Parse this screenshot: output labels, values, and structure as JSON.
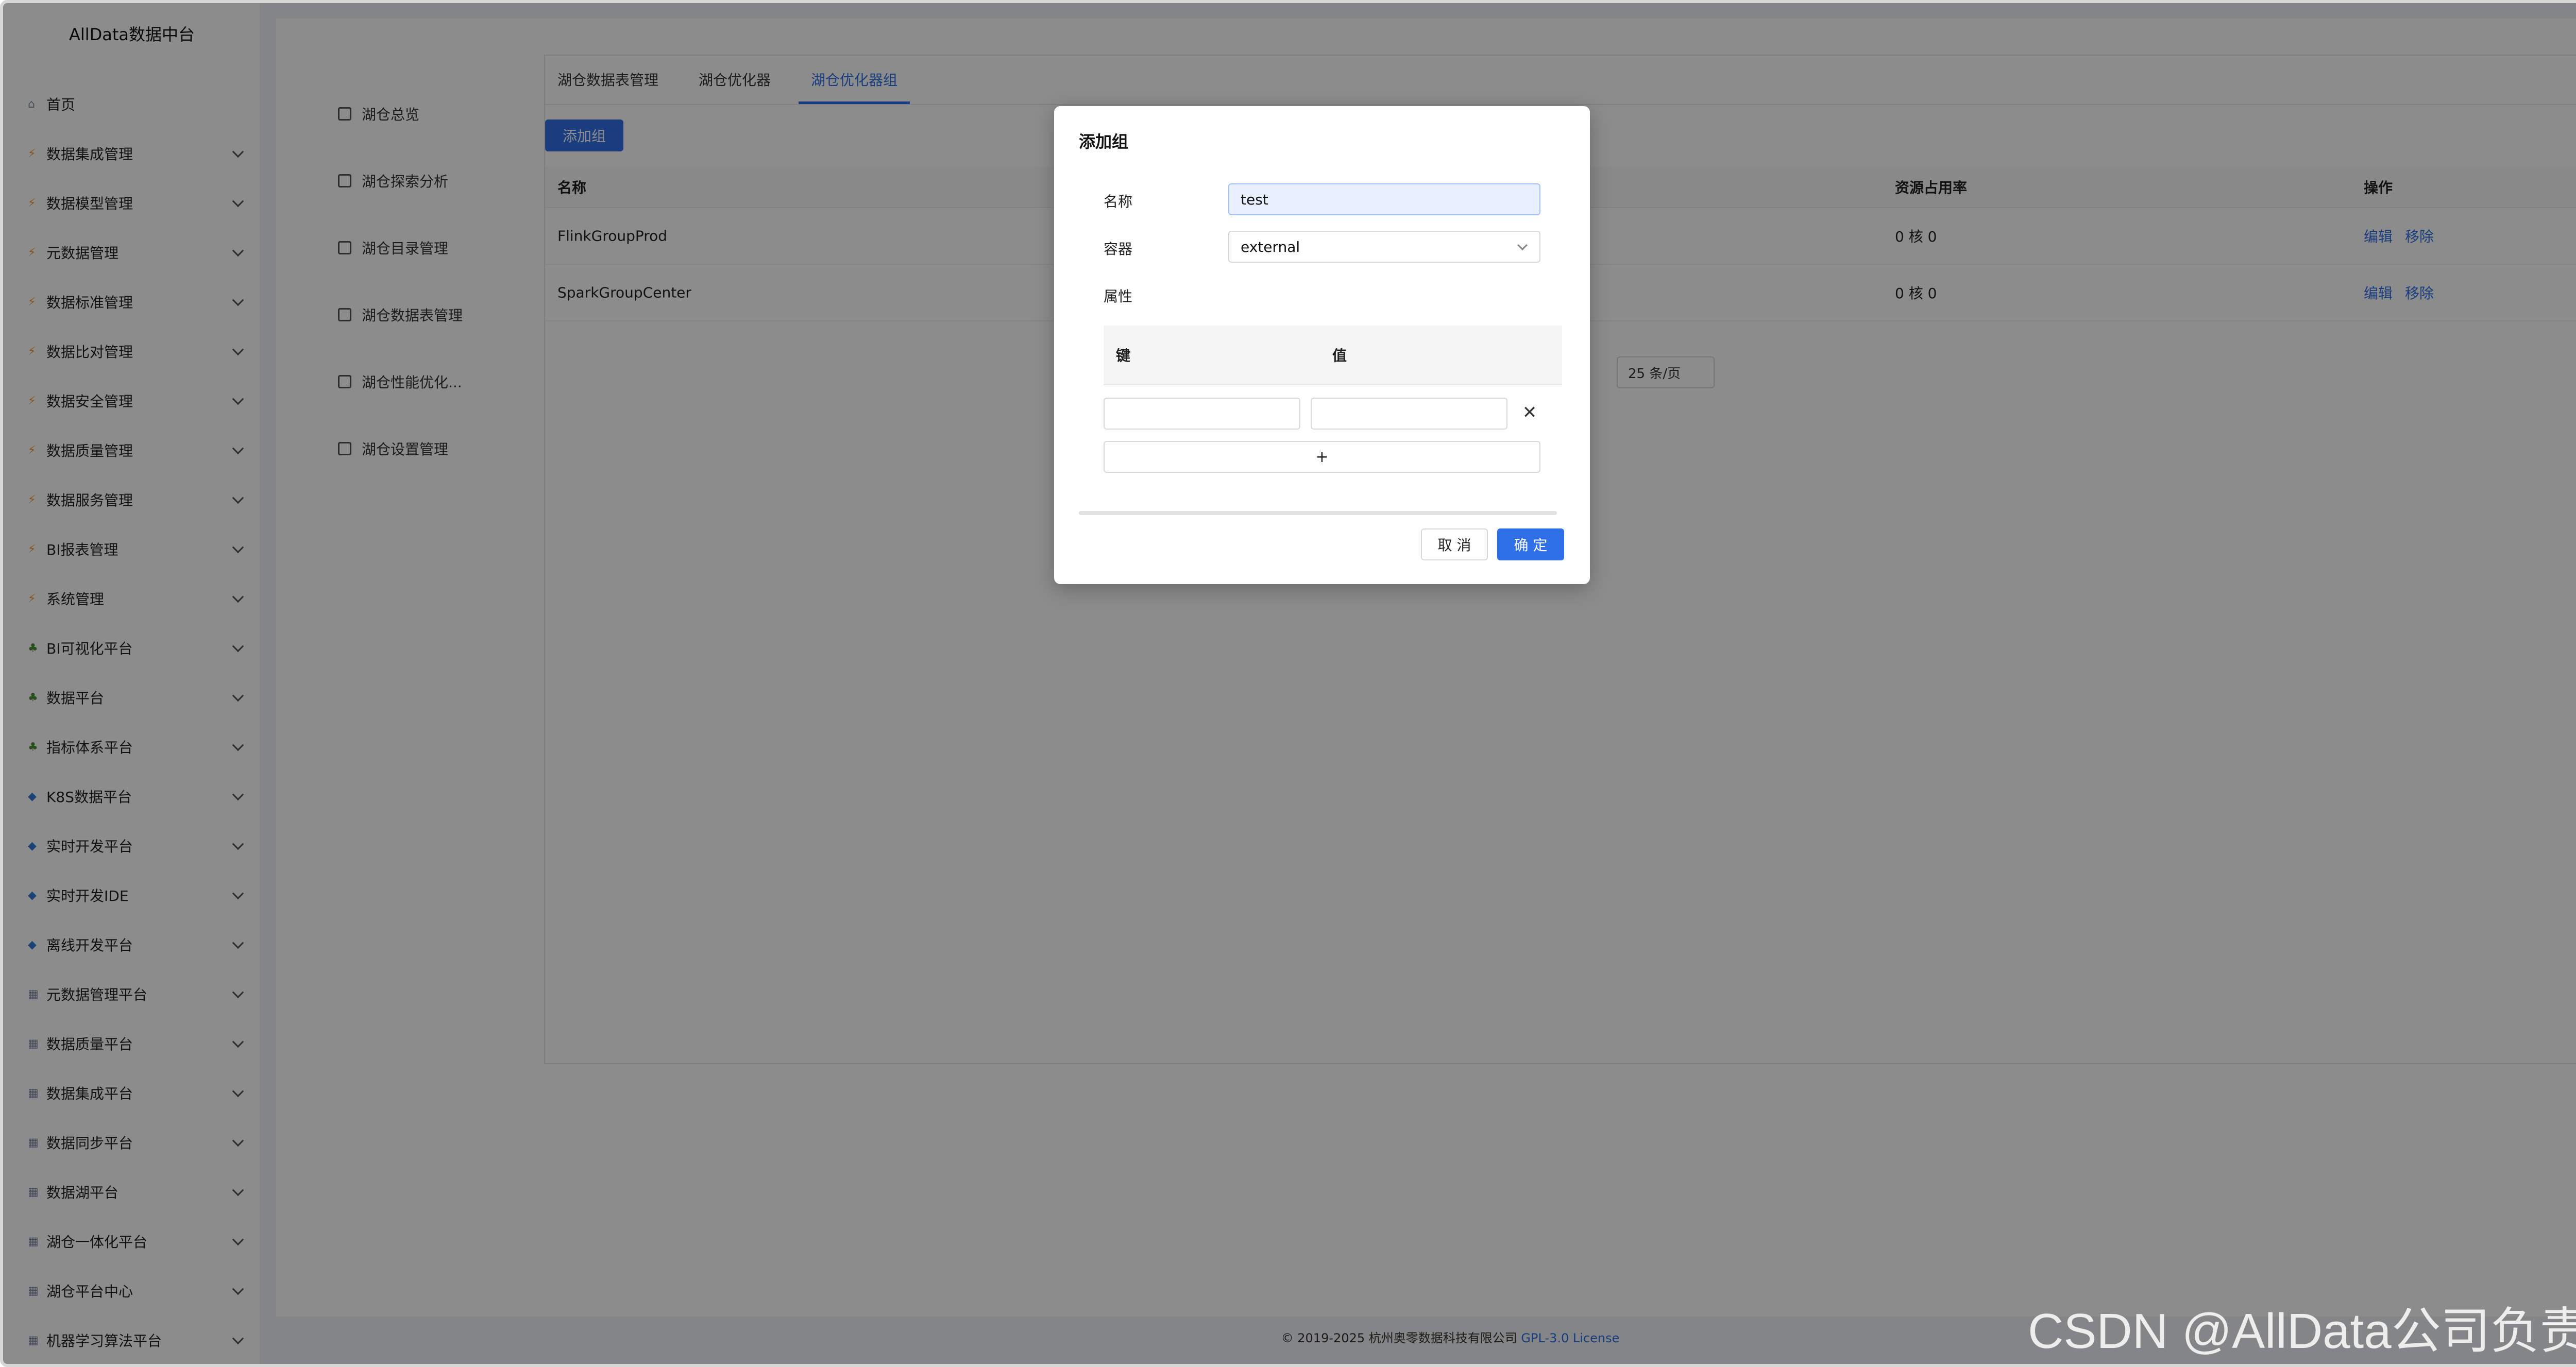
{
  "app": {
    "brand": "AllData数据中台"
  },
  "sidebar": {
    "items": [
      {
        "label": "首页",
        "icon": "home-icon",
        "expandable": false
      },
      {
        "label": "数据集成管理",
        "icon": "lightning-icon",
        "expandable": true
      },
      {
        "label": "数据模型管理",
        "icon": "lightning-icon",
        "expandable": true
      },
      {
        "label": "元数据管理",
        "icon": "lightning-icon",
        "expandable": true
      },
      {
        "label": "数据标准管理",
        "icon": "lightning-icon",
        "expandable": true
      },
      {
        "label": "数据比对管理",
        "icon": "lightning-icon",
        "expandable": true
      },
      {
        "label": "数据安全管理",
        "icon": "lightning-icon",
        "expandable": true
      },
      {
        "label": "数据质量管理",
        "icon": "lightning-icon",
        "expandable": true
      },
      {
        "label": "数据服务管理",
        "icon": "lightning-icon",
        "expandable": true
      },
      {
        "label": "BI报表管理",
        "icon": "lightning-icon",
        "expandable": true
      },
      {
        "label": "系统管理",
        "icon": "lightning-icon",
        "expandable": true
      },
      {
        "label": "BI可视化平台",
        "icon": "tree-icon",
        "expandable": true
      },
      {
        "label": "数据平台",
        "icon": "tree-icon",
        "expandable": true
      },
      {
        "label": "指标体系平台",
        "icon": "tree-icon",
        "expandable": true
      },
      {
        "label": "K8S数据平台",
        "icon": "diamond-icon",
        "expandable": true
      },
      {
        "label": "实时开发平台",
        "icon": "diamond-icon",
        "expandable": true
      },
      {
        "label": "实时开发IDE",
        "icon": "diamond-icon",
        "expandable": true
      },
      {
        "label": "离线开发平台",
        "icon": "diamond-icon",
        "expandable": true
      },
      {
        "label": "元数据管理平台",
        "icon": "grid-icon",
        "expandable": true
      },
      {
        "label": "数据质量平台",
        "icon": "grid-icon",
        "expandable": true
      },
      {
        "label": "数据集成平台",
        "icon": "grid-icon",
        "expandable": true
      },
      {
        "label": "数据同步平台",
        "icon": "grid-icon",
        "expandable": true
      },
      {
        "label": "数据湖平台",
        "icon": "grid-icon",
        "expandable": true
      },
      {
        "label": "湖仓一体化平台",
        "icon": "grid-icon",
        "expandable": true
      },
      {
        "label": "湖仓平台中心",
        "icon": "grid-icon",
        "expandable": true
      },
      {
        "label": "机器学习算法平台",
        "icon": "grid-icon",
        "expandable": true
      }
    ]
  },
  "subnav": {
    "items": [
      {
        "label": "湖仓总览",
        "icon": "dashboard-icon"
      },
      {
        "label": "湖仓探索分析",
        "icon": "explore-icon"
      },
      {
        "label": "湖仓目录管理",
        "icon": "catalog-icon"
      },
      {
        "label": "湖仓数据表管理",
        "icon": "table-icon"
      },
      {
        "label": "湖仓性能优化...",
        "icon": "speed-icon"
      },
      {
        "label": "湖仓设置管理",
        "icon": "monitor-icon"
      }
    ]
  },
  "tabs": [
    {
      "label": "湖仓数据表管理",
      "active": false
    },
    {
      "label": "湖仓优化器",
      "active": false
    },
    {
      "label": "湖仓优化器组",
      "active": true
    }
  ],
  "toolbar": {
    "add_label": "添加组"
  },
  "table": {
    "headers": {
      "name": "名称",
      "resource": "资源占用率",
      "actions": "操作"
    },
    "rows": [
      {
        "name": "FlinkGroupProd",
        "resource": "0 核 0",
        "edit": "编辑",
        "remove": "移除"
      },
      {
        "name": "SparkGroupCenter",
        "resource": "0 核 0",
        "edit": "编辑",
        "remove": "移除"
      }
    ]
  },
  "pager": {
    "page_size": "25 条/页"
  },
  "footer": {
    "copyright": "© 2019-2025 杭州奥零数据科技有限公司",
    "license": "GPL-3.0 License"
  },
  "modal": {
    "title": "添加组",
    "name_label": "名称",
    "name_value": "test",
    "container_label": "容器",
    "container_value": "external",
    "props_label": "属性",
    "key_header": "键",
    "value_header": "值",
    "key_value": "",
    "value_value": "",
    "remove_symbol": "✕",
    "add_symbol": "+",
    "cancel_label": "取 消",
    "ok_label": "确 定"
  },
  "watermark": "CSDN @AllData公司负责人",
  "colors": {
    "primary": "#2f6fe8",
    "overlay": "rgba(0,0,0,0.45)"
  }
}
